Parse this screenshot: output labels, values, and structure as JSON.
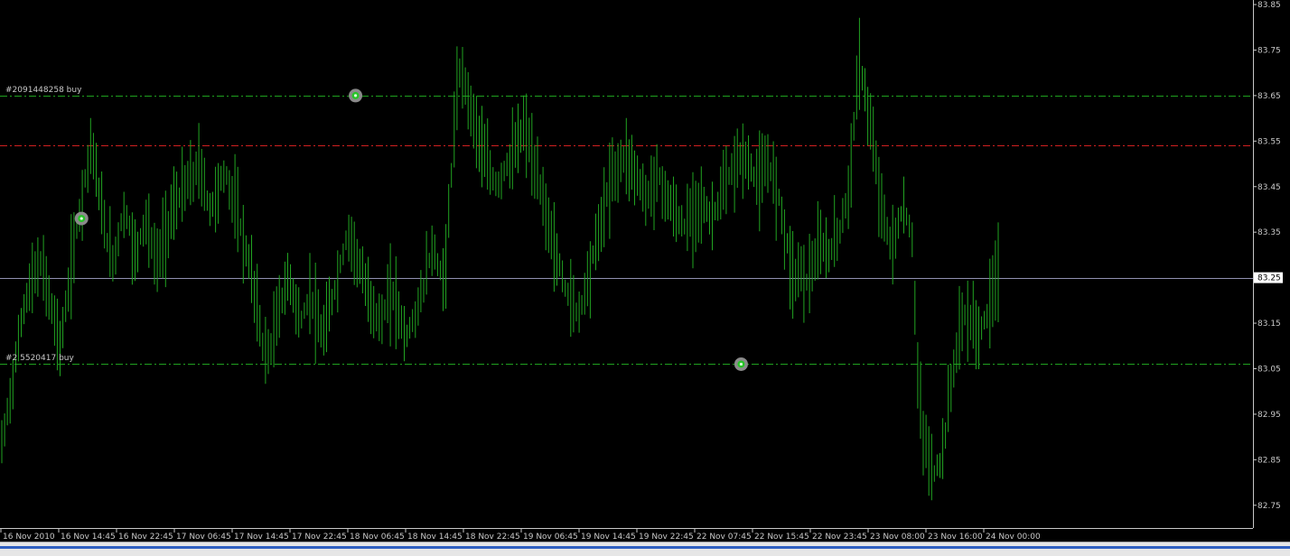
{
  "chart_data": {
    "type": "line",
    "style": "bars",
    "bar_color": "#21a321",
    "background": "#000000",
    "price_axis": {
      "ylim": [
        82.7,
        83.86
      ],
      "ticks": [
        "83.85",
        "83.75",
        "83.65",
        "83.55",
        "83.45",
        "83.35",
        "83.25",
        "83.15",
        "83.05",
        "82.95",
        "82.85",
        "82.75"
      ],
      "current_price_label": "83.25"
    },
    "time_axis": {
      "ticks": [
        "16 Nov 2010",
        "16 Nov 14:45",
        "16 Nov 22:45",
        "17 Nov 06:45",
        "17 Nov 14:45",
        "17 Nov 22:45",
        "18 Nov 06:45",
        "18 Nov 14:45",
        "18 Nov 22:45",
        "19 Nov 06:45",
        "19 Nov 14:45",
        "19 Nov 22:45",
        "22 Nov 07:45",
        "22 Nov 15:45",
        "22 Nov 23:45",
        "23 Nov 08:00",
        "23 Nov 16:00",
        "24 Nov 00:00"
      ]
    },
    "levels": [
      {
        "price": 83.65,
        "color": "#1fa01f",
        "style": "dashdot",
        "label": "#2091448258 buy"
      },
      {
        "price": 83.54,
        "color": "#d02020",
        "style": "dashdot",
        "label": ""
      },
      {
        "price": 83.25,
        "color": "#9090b0",
        "style": "solid",
        "label": ""
      },
      {
        "price": 83.06,
        "color": "#1fa01f",
        "style": "dashdot",
        "label": "#2 5520417 buy"
      }
    ],
    "markers": [
      {
        "time_index": 0.08,
        "price": 83.38
      },
      {
        "time_index": 0.355,
        "price": 83.65
      },
      {
        "time_index": 0.742,
        "price": 83.06
      }
    ],
    "series": [
      {
        "values": [
          82.88,
          82.95,
          83.02,
          83.1,
          83.18,
          83.22,
          83.25,
          83.28,
          83.26,
          83.2,
          83.15,
          83.1,
          83.18,
          83.27,
          83.35,
          83.42,
          83.5,
          83.55,
          83.45,
          83.38,
          83.32,
          83.28,
          83.35,
          83.4,
          83.36,
          83.3,
          83.34,
          83.38,
          83.33,
          83.28,
          83.32,
          83.35,
          83.4,
          83.42,
          83.44,
          83.46,
          83.47,
          83.5,
          83.45,
          83.4,
          83.42,
          83.46,
          83.48,
          83.44,
          83.4,
          83.35,
          83.3,
          83.25,
          83.18,
          83.1,
          83.08,
          83.12,
          83.18,
          83.22,
          83.25,
          83.2,
          83.15,
          83.18,
          83.22,
          83.16,
          83.12,
          83.15,
          83.2,
          83.25,
          83.3,
          83.35,
          83.32,
          83.28,
          83.24,
          83.2,
          83.18,
          83.15,
          83.18,
          83.22,
          83.2,
          83.15,
          83.12,
          83.15,
          83.18,
          83.22,
          83.28,
          83.32,
          83.27,
          83.24,
          83.4,
          83.6,
          83.7,
          83.68,
          83.62,
          83.58,
          83.54,
          83.5,
          83.47,
          83.45,
          83.48,
          83.5,
          83.52,
          83.55,
          83.58,
          83.55,
          83.48,
          83.45,
          83.4,
          83.35,
          83.3,
          83.26,
          83.22,
          83.2,
          83.17,
          83.2,
          83.25,
          83.3,
          83.35,
          83.4,
          83.45,
          83.48,
          83.5,
          83.52,
          83.5,
          83.48,
          83.45,
          83.42,
          83.45,
          83.48,
          83.45,
          83.42,
          83.4,
          83.38,
          83.36,
          83.38,
          83.4,
          83.42,
          83.4,
          83.38,
          83.4,
          83.43,
          83.46,
          83.48,
          83.5,
          83.52,
          83.5,
          83.48,
          83.46,
          83.48,
          83.5,
          83.46,
          83.42,
          83.35,
          83.28,
          83.25,
          83.27,
          83.24,
          83.27,
          83.3,
          83.32,
          83.3,
          83.32,
          83.35,
          83.38,
          83.45,
          83.6,
          83.72,
          83.66,
          83.58,
          83.5,
          83.42,
          83.35,
          83.32,
          83.35,
          83.4,
          83.38,
          83.32,
          83.0,
          82.9,
          82.85,
          82.82,
          82.84,
          82.9,
          83.0,
          83.08,
          83.15,
          83.17,
          83.15,
          83.13,
          83.14,
          83.17,
          83.22,
          83.27
        ]
      }
    ]
  }
}
